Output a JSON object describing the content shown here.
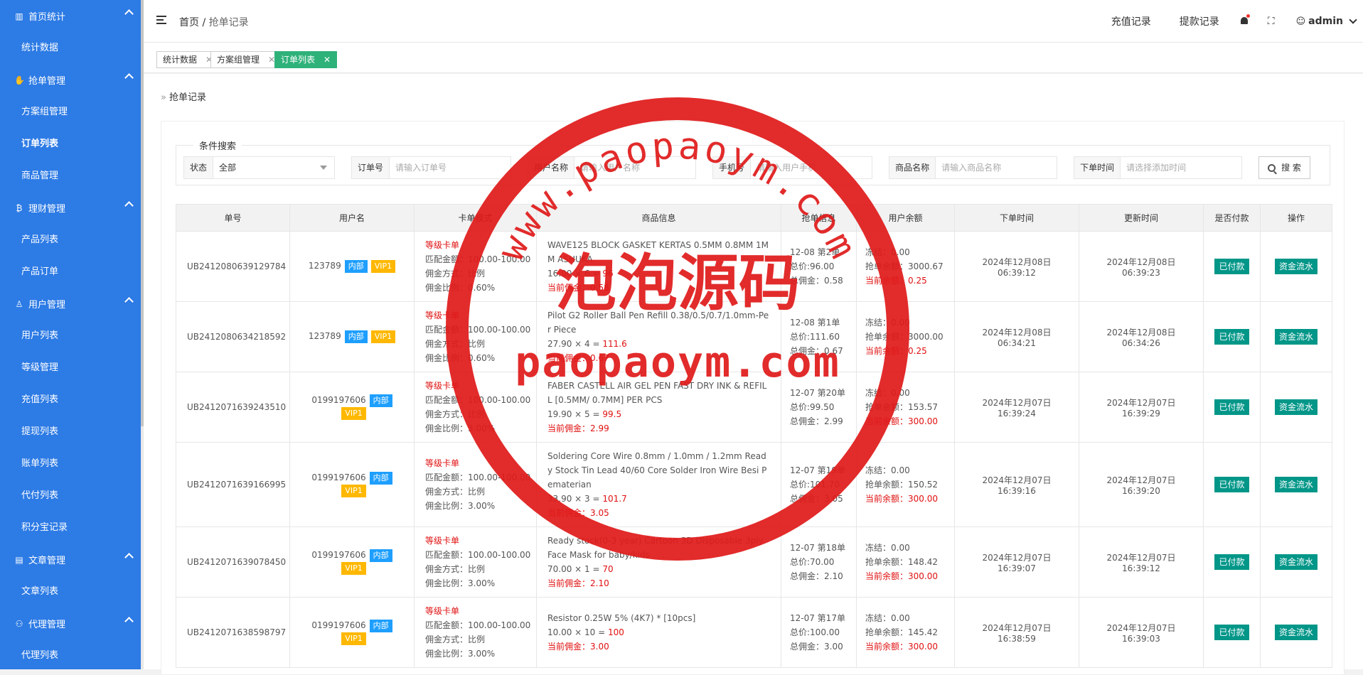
{
  "sidebar": {
    "groups": [
      {
        "label": "首页统计",
        "icon": "bar-chart-icon",
        "items": [
          "统计数据"
        ]
      },
      {
        "label": "抢单管理",
        "icon": "hand-icon",
        "items": [
          "方案组管理",
          "订单列表",
          "商品管理"
        ]
      },
      {
        "label": "理财管理",
        "icon": "bitcoin-icon",
        "items": [
          "产品列表",
          "产品订单"
        ]
      },
      {
        "label": "用户管理",
        "icon": "user-icon",
        "items": [
          "用户列表",
          "等级管理",
          "充值列表",
          "提现列表",
          "账单列表",
          "代付列表",
          "积分宝记录"
        ]
      },
      {
        "label": "文章管理",
        "icon": "document-icon",
        "items": [
          "文章列表"
        ]
      },
      {
        "label": "代理管理",
        "icon": "agent-icon",
        "items": [
          "代理列表"
        ]
      }
    ],
    "active_item": "订单列表"
  },
  "header": {
    "breadcrumb_home": "首页",
    "breadcrumb_sep": "/",
    "breadcrumb_current": "抢单记录",
    "recharge_link": "充值记录",
    "withdraw_link": "提款记录",
    "user_name": "admin"
  },
  "tabs": [
    {
      "label": "统计数据",
      "active": false
    },
    {
      "label": "方案组管理",
      "active": false
    },
    {
      "label": "订单列表",
      "active": true
    }
  ],
  "page_title": "抢单记录",
  "search": {
    "legend": "条件搜索",
    "status_label": "状态",
    "status_value": "全部",
    "order_label": "订单号",
    "order_placeholder": "请输入订单号",
    "username_label": "用户名称",
    "username_placeholder": "请输入用户名称",
    "phone_label": "手机号",
    "phone_placeholder": "请输入用户手机",
    "goods_label": "商品名称",
    "goods_placeholder": "请输入商品名称",
    "time_label": "下单时间",
    "time_placeholder": "请选择添加时间",
    "search_button": "搜 索"
  },
  "table": {
    "columns": [
      "单号",
      "用户名",
      "卡单模式",
      "商品信息",
      "抢单信息",
      "用户余额",
      "下单时间",
      "更新时间",
      "是否付款",
      "操作"
    ],
    "tag_internal": "内部",
    "paid_label": "已付款",
    "flow_button": "资金流水",
    "rows": [
      {
        "order_no": "UB2412080639129784",
        "user": "123789",
        "vip": "VIP1",
        "mode": [
          "等级卡单",
          "匹配金额：100.00-100.00",
          "佣金方式：比例",
          "佣金比例：0.60%"
        ],
        "goods_name": "WAVE125 BLOCK GASKET KERTAS 0.5MM 0.8MM 1MM ASHUKA",
        "goods_calc": "16.00 × 6 = ",
        "goods_total": "96",
        "commission": "当前佣金：0.58",
        "grab": [
          "12-08 第2单",
          "总价:96.00",
          "总佣金：0.58"
        ],
        "balance": [
          "冻结：0.00",
          "抢单余额：3000.67",
          "当前余额：0.25"
        ],
        "created": "2024年12月08日 06:39:12",
        "updated": "2024年12月08日 06:39:23"
      },
      {
        "order_no": "UB2412080634218592",
        "user": "123789",
        "vip": "VIP1",
        "mode": [
          "等级卡单",
          "匹配金额：100.00-100.00",
          "佣金方式：比例",
          "佣金比例：0.60%"
        ],
        "goods_name": "Pilot G2 Roller Ball Pen Refill 0.38/0.5/0.7/1.0mm-Per Piece",
        "goods_calc": "27.90 × 4 = ",
        "goods_total": "111.6",
        "commission": "当前佣金：0.67",
        "grab": [
          "12-08 第1单",
          "总价:111.60",
          "总佣金：0.67"
        ],
        "balance": [
          "冻结：0.00",
          "抢单余额：3000.00",
          "当前余额：0.25"
        ],
        "created": "2024年12月08日 06:34:21",
        "updated": "2024年12月08日 06:34:26"
      },
      {
        "order_no": "UB2412071639243510",
        "user": "0199197606",
        "vip": "VIP1",
        "mode": [
          "等级卡单",
          "匹配金额：100.00-100.00",
          "佣金方式：比例",
          "佣金比例：3.00%"
        ],
        "goods_name": "FABER CASTELL AIR GEL PEN FAST DRY INK & REFILL [0.5MM/ 0.7MM] PER PCS",
        "goods_calc": "19.90 × 5 = ",
        "goods_total": "99.5",
        "commission": "当前佣金：2.99",
        "grab": [
          "12-07 第20单",
          "总价:99.50",
          "总佣金：2.99"
        ],
        "balance": [
          "冻结：0.00",
          "抢单余额：153.57",
          "当前余额：300.00"
        ],
        "created": "2024年12月07日 16:39:24",
        "updated": "2024年12月07日 16:39:29"
      },
      {
        "order_no": "UB2412071639166995",
        "user": "0199197606",
        "vip": "VIP1",
        "mode": [
          "等级卡单",
          "匹配金额：100.00-100.00",
          "佣金方式：比例",
          "佣金比例：3.00%"
        ],
        "goods_name": "Soldering Core Wire 0.8mm / 1.0mm / 1.2mm Ready Stock Tin Lead 40/60 Core Solder Iron Wire Besi Pematerian",
        "goods_calc": "33.90 × 3 = ",
        "goods_total": "101.7",
        "commission": "当前佣金：3.05",
        "grab": [
          "12-07 第19单",
          "总价:101.70",
          "总佣金：3.05"
        ],
        "balance": [
          "冻结：0.00",
          "抢单余额：150.52",
          "当前余额：300.00"
        ],
        "created": "2024年12月07日 16:39:16",
        "updated": "2024年12月07日 16:39:20"
      },
      {
        "order_no": "UB2412071639078450",
        "user": "0199197606",
        "vip": "VIP1",
        "mode": [
          "等级卡单",
          "匹配金额：100.00-100.00",
          "佣金方式：比例",
          "佣金比例：3.00%"
        ],
        "goods_name": "Ready stock(0-3 year) Cartoon 3D Disposable 3ply Face Mask for baby/kids",
        "goods_calc": "70.00 × 1 = ",
        "goods_total": "70",
        "commission": "当前佣金：2.10",
        "grab": [
          "12-07 第18单",
          "总价:70.00",
          "总佣金：2.10"
        ],
        "balance": [
          "冻结：0.00",
          "抢单余额：148.42",
          "当前余额：300.00"
        ],
        "created": "2024年12月07日 16:39:07",
        "updated": "2024年12月07日 16:39:12"
      },
      {
        "order_no": "UB2412071638598797",
        "user": "0199197606",
        "vip": "VIP1",
        "mode": [
          "等级卡单",
          "匹配金额：100.00-100.00",
          "佣金方式：比例",
          "佣金比例：3.00%"
        ],
        "goods_name": "Resistor 0.25W 5% (4K7) * [10pcs]",
        "goods_calc": "10.00 × 10 = ",
        "goods_total": "100",
        "commission": "当前佣金：3.00",
        "grab": [
          "12-07 第17单",
          "总价:100.00",
          "总佣金：3.00"
        ],
        "balance": [
          "冻结：0.00",
          "抢单余额：145.42",
          "当前余额：300.00"
        ],
        "created": "2024年12月07日 16:38:59",
        "updated": "2024年12月07日 16:39:03"
      }
    ]
  },
  "watermark": {
    "url_arc": "www.paopaoym.com",
    "center": "泡泡源码",
    "bottom": "paopaoym.com",
    "color": "#e01a1a"
  },
  "colors": {
    "sidebar": "#2d7be5",
    "active_tab": "#2fb27a",
    "paid": "#009688",
    "tag_internal": "#1e9fff",
    "tag_vip": "#ffb800",
    "alert": "#e01010"
  }
}
